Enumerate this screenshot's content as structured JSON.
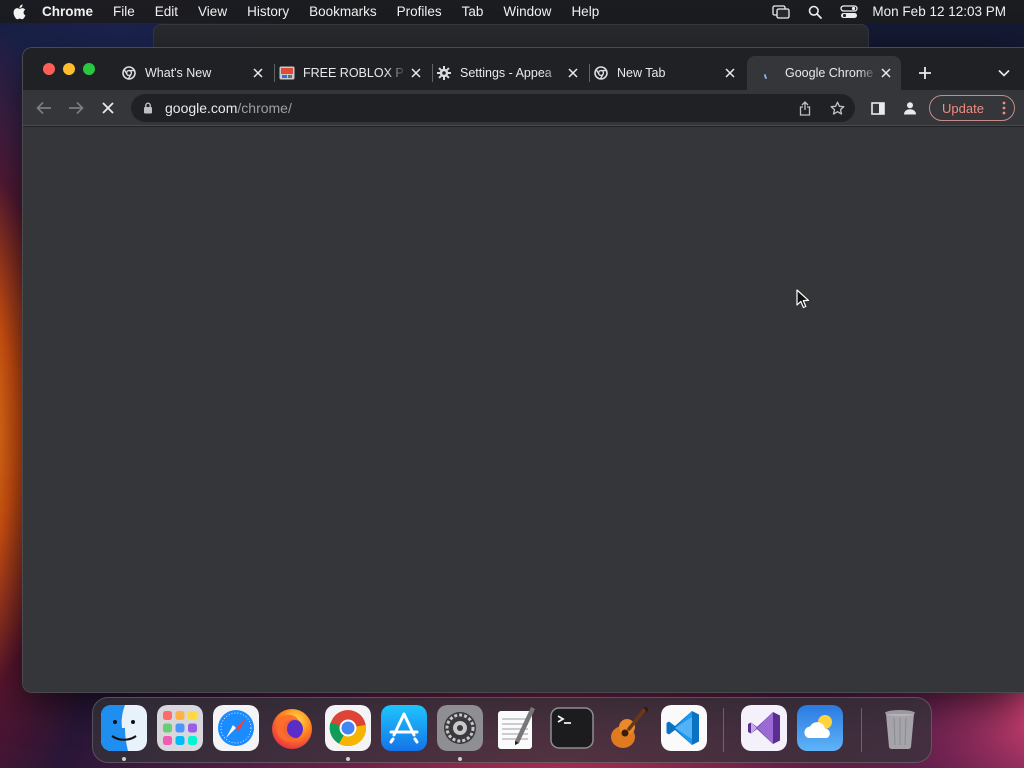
{
  "menubar": {
    "app_name": "Chrome",
    "items": [
      "File",
      "Edit",
      "View",
      "History",
      "Bookmarks",
      "Profiles",
      "Tab",
      "Window",
      "Help"
    ],
    "clock": "Mon Feb 12  12:03 PM",
    "status_icons": [
      "screen-mirroring-icon",
      "spotlight-search-icon",
      "control-center-icon"
    ]
  },
  "browser": {
    "tabs": [
      {
        "title": "What's New",
        "favicon": "chrome-icon"
      },
      {
        "title": "FREE ROBLOX P",
        "favicon": "roblox-page-icon"
      },
      {
        "title": "Settings - Appea",
        "favicon": "settings-gear-icon"
      },
      {
        "title": "New Tab",
        "favicon": "chrome-icon"
      },
      {
        "title": "Google Chrome",
        "favicon": "loading-spinner-icon",
        "active": true
      }
    ],
    "url_host": "google.com",
    "url_path": "/chrome/",
    "update_label": "Update",
    "loading": true
  },
  "dock": {
    "apps": [
      {
        "name": "Finder",
        "icon": "finder-icon",
        "running": true
      },
      {
        "name": "Launchpad",
        "icon": "launchpad-icon",
        "running": false
      },
      {
        "name": "Safari",
        "icon": "safari-icon",
        "running": false
      },
      {
        "name": "Firefox",
        "icon": "firefox-icon",
        "running": false
      },
      {
        "name": "Google Chrome",
        "icon": "chrome-icon",
        "running": true
      },
      {
        "name": "App Store",
        "icon": "app-store-icon",
        "running": false
      },
      {
        "name": "System Settings",
        "icon": "system-settings-icon",
        "running": true
      },
      {
        "name": "TextEdit",
        "icon": "textedit-icon",
        "running": false
      },
      {
        "name": "Terminal",
        "icon": "terminal-icon",
        "running": false
      },
      {
        "name": "GarageBand",
        "icon": "garageband-icon",
        "running": false
      },
      {
        "name": "Visual Studio Code",
        "icon": "vscode-icon",
        "running": false
      },
      {
        "name": "Visual Studio",
        "icon": "visual-studio-icon",
        "running": false
      },
      {
        "name": "Weather",
        "icon": "weather-icon",
        "running": false
      },
      {
        "name": "Trash",
        "icon": "trash-icon",
        "running": false
      }
    ]
  },
  "colors": {
    "window_bg": "#202124",
    "toolbar_bg": "#35363a",
    "update_accent": "#f28b82",
    "traffic_close": "#ff5f57",
    "traffic_min": "#febc2e",
    "traffic_max": "#28c840"
  }
}
